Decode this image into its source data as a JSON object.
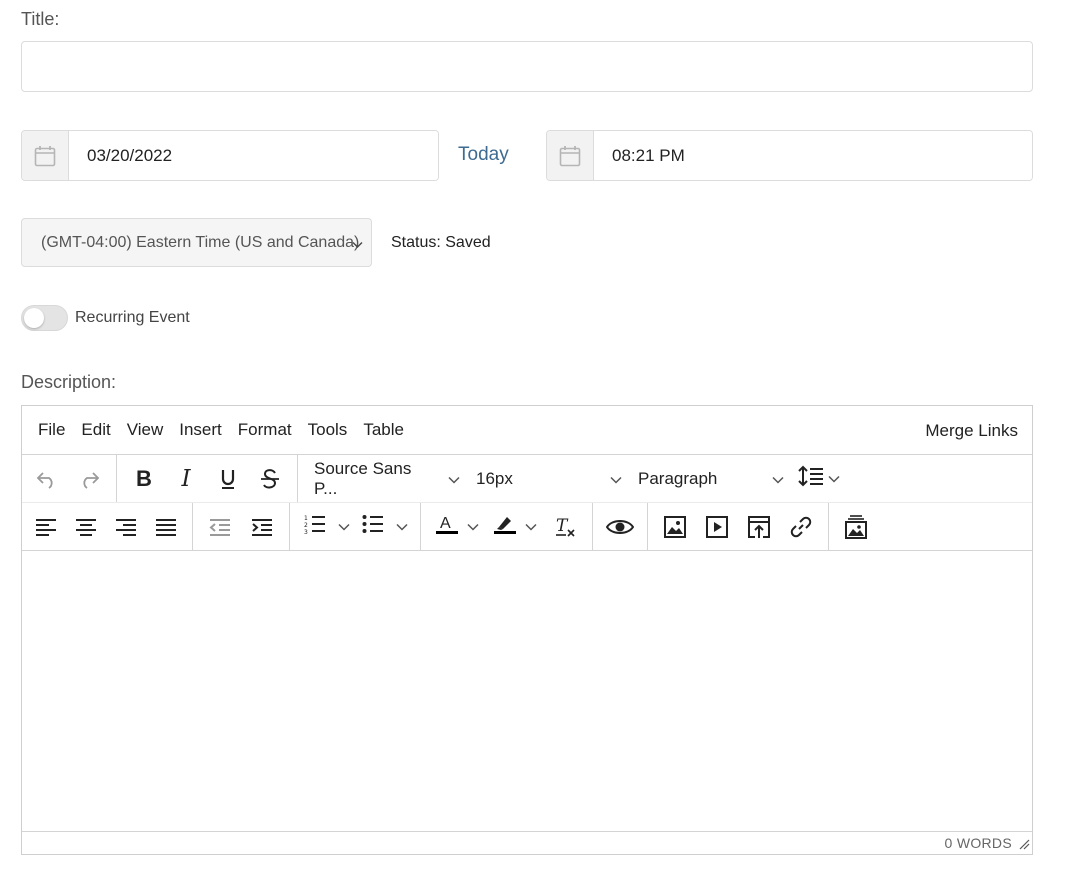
{
  "form": {
    "title_label": "Title:",
    "title_value": "",
    "date_value": "03/20/2022",
    "today_link": "Today",
    "time_value": "08:21 PM",
    "timezone": "(GMT-04:00) Eastern Time (US and Canada)",
    "status": "Status: Saved",
    "recurring_label": "Recurring Event",
    "recurring_on": false,
    "description_label": "Description:"
  },
  "editor": {
    "menu": [
      "File",
      "Edit",
      "View",
      "Insert",
      "Format",
      "Tools",
      "Table"
    ],
    "merge_links": "Merge Links",
    "font_family": "Source Sans P...",
    "font_size": "16px",
    "block_format": "Paragraph",
    "word_count": "0 WORDS",
    "icons": [
      "undo-icon",
      "redo-icon",
      "bold-icon",
      "italic-icon",
      "underline-icon",
      "strikethrough-icon",
      "line-height-icon",
      "align-left-icon",
      "align-center-icon",
      "align-right-icon",
      "justify-icon",
      "outdent-icon",
      "indent-icon",
      "numbered-list-icon",
      "bullet-list-icon",
      "text-color-icon",
      "highlight-icon",
      "clear-formatting-icon",
      "preview-icon",
      "image-icon",
      "media-icon",
      "upload-icon",
      "link-icon",
      "gallery-icon"
    ]
  },
  "colors": {
    "link": "#3e6b92",
    "border": "#dcdcdc",
    "addon_bg": "#f2f2f2"
  }
}
